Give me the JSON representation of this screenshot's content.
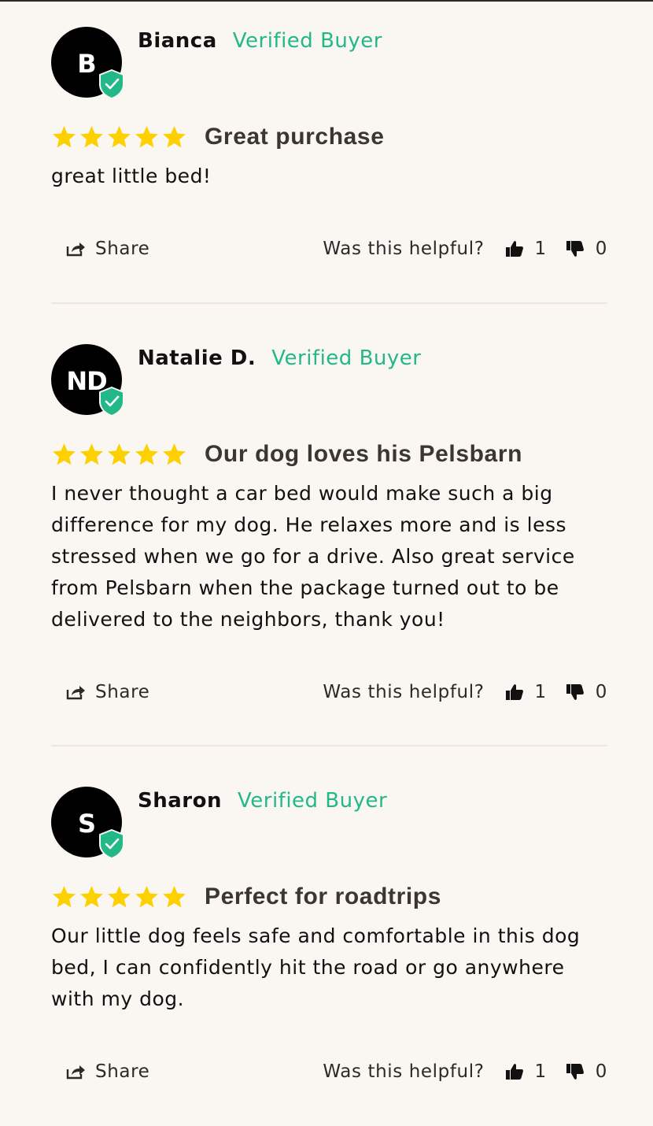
{
  "colors": {
    "background": "#faf6f1",
    "verified": "#23b887",
    "star": "#fdd000",
    "shield": "#23b887",
    "title": "#3b3631"
  },
  "icons": {
    "share": "share-icon",
    "thumbs_up": "thumbs-up-icon",
    "thumbs_down": "thumbs-down-icon",
    "star": "star-icon",
    "verified_shield": "verified-shield-icon"
  },
  "reviews": [
    {
      "initials": "B",
      "name": "Bianca",
      "badge": "Verified Buyer",
      "rating": 5,
      "title": "Great purchase",
      "body": "great little bed!",
      "share_label": "Share",
      "helpful_question": "Was this helpful?",
      "upvotes": "1",
      "downvotes": "0"
    },
    {
      "initials": "ND",
      "name": "Natalie D.",
      "badge": "Verified Buyer",
      "rating": 5,
      "title": "Our dog loves his Pelsbarn",
      "body": "I never thought a car bed would make such a big difference for my dog. He relaxes more and is less stressed when we go for a drive. Also great service from Pelsbarn when the package turned out to be delivered to the neighbors, thank you!",
      "share_label": "Share",
      "helpful_question": "Was this helpful?",
      "upvotes": "1",
      "downvotes": "0"
    },
    {
      "initials": "S",
      "name": "Sharon",
      "badge": "Verified Buyer",
      "rating": 5,
      "title": "Perfect for roadtrips",
      "body": "Our little dog feels safe and comfortable in this dog bed, I can confidently hit the road or go anywhere with my dog.",
      "share_label": "Share",
      "helpful_question": "Was this helpful?",
      "upvotes": "1",
      "downvotes": "0"
    }
  ]
}
